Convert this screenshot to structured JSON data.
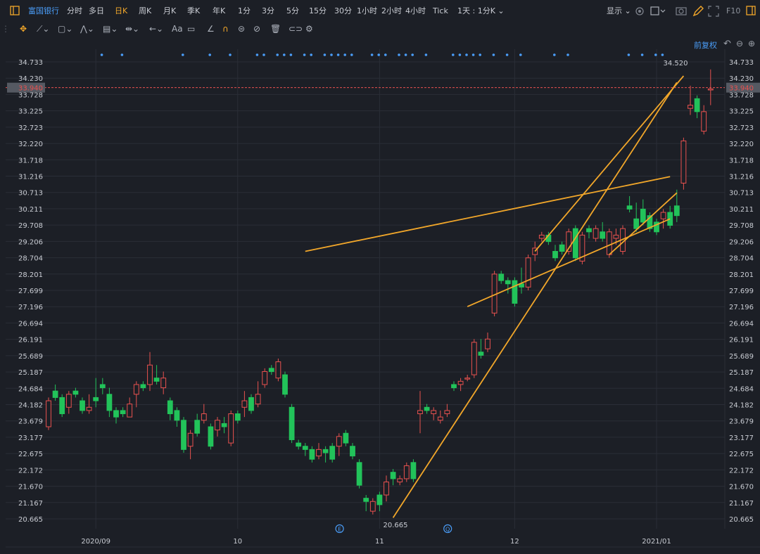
{
  "topbar": {
    "stock_name": "富国银行",
    "periods": [
      "分时",
      "多日",
      "日K",
      "周K",
      "月K",
      "季K",
      "年K",
      "1分",
      "3分",
      "5分",
      "15分",
      "30分",
      "1小时",
      "2小时",
      "4小时",
      "Tick",
      "1天 : 1分K"
    ],
    "active_period": "日K",
    "display_label": "显示",
    "f10_label": "F10"
  },
  "toolbar": {
    "text_tool_label": "Aa"
  },
  "adjust_label": "前复权",
  "colors": {
    "up": "#e8514f",
    "down": "#22c35a",
    "trend": "#f2a72a",
    "bg": "#1c1f26",
    "grid": "#2a2e37",
    "accent": "#4a9df8"
  },
  "chart_data": {
    "type": "candlestick",
    "current_price": "33.940",
    "high_label": "34.520",
    "low_label": "20.665",
    "ylim": [
      20.3,
      35.2
    ],
    "y_ticks": [
      "34.733",
      "34.230",
      "33.728",
      "33.225",
      "32.723",
      "32.220",
      "31.718",
      "31.216",
      "30.713",
      "30.211",
      "29.708",
      "29.206",
      "28.704",
      "28.201",
      "27.699",
      "27.196",
      "26.694",
      "26.191",
      "25.689",
      "25.187",
      "24.684",
      "24.182",
      "23.679",
      "23.177",
      "22.675",
      "22.172",
      "21.670",
      "21.167",
      "20.665"
    ],
    "x_labels": [
      {
        "label": "2020/09",
        "index": 7
      },
      {
        "label": "10",
        "index": 28
      },
      {
        "label": "11",
        "index": 49
      },
      {
        "label": "12",
        "index": 69
      },
      {
        "label": "2021/01",
        "index": 90
      }
    ],
    "candles": [
      [
        23.5,
        24.3,
        23.4,
        24.4
      ],
      [
        24.6,
        24.4,
        24.3,
        24.8
      ],
      [
        24.4,
        23.9,
        23.8,
        24.5
      ],
      [
        24.1,
        24.5,
        23.9,
        24.6
      ],
      [
        24.6,
        24.5,
        24.4,
        24.7
      ],
      [
        24.3,
        24.0,
        23.9,
        24.4
      ],
      [
        24.0,
        24.1,
        23.9,
        24.5
      ],
      [
        24.4,
        24.3,
        24.1,
        25.0
      ],
      [
        24.8,
        24.7,
        24.5,
        25.0
      ],
      [
        24.5,
        24.0,
        23.8,
        24.7
      ],
      [
        24.0,
        23.8,
        23.6,
        24.1
      ],
      [
        24.0,
        23.9,
        23.8,
        24.1
      ],
      [
        23.8,
        24.2,
        23.8,
        24.4
      ],
      [
        24.5,
        24.8,
        24.1,
        24.9
      ],
      [
        24.8,
        24.7,
        24.6,
        24.9
      ],
      [
        24.8,
        25.4,
        24.6,
        25.8
      ],
      [
        25.0,
        24.9,
        24.8,
        25.4
      ],
      [
        24.7,
        25.0,
        24.5,
        25.2
      ],
      [
        24.3,
        23.9,
        23.7,
        24.4
      ],
      [
        24.0,
        23.7,
        23.5,
        24.1
      ],
      [
        23.7,
        22.8,
        22.7,
        23.8
      ],
      [
        22.9,
        23.3,
        22.5,
        23.4
      ],
      [
        23.7,
        23.3,
        23.2,
        23.9
      ],
      [
        23.7,
        23.9,
        23.6,
        24.2
      ],
      [
        23.5,
        22.9,
        22.8,
        23.6
      ],
      [
        23.4,
        23.7,
        23.2,
        23.8
      ],
      [
        23.6,
        23.5,
        23.3,
        23.8
      ],
      [
        23.0,
        23.9,
        22.9,
        24.0
      ],
      [
        23.9,
        23.7,
        23.6,
        24.0
      ],
      [
        24.1,
        24.3,
        23.8,
        24.6
      ],
      [
        24.4,
        24.0,
        23.9,
        24.5
      ],
      [
        24.2,
        24.5,
        24.1,
        24.9
      ],
      [
        24.8,
        25.2,
        24.7,
        25.3
      ],
      [
        25.3,
        25.2,
        25.1,
        25.4
      ],
      [
        25.0,
        25.5,
        24.9,
        25.6
      ],
      [
        25.1,
        24.5,
        24.4,
        25.2
      ],
      [
        24.1,
        23.1,
        23.0,
        24.2
      ],
      [
        23.0,
        22.9,
        22.8,
        23.1
      ],
      [
        22.9,
        22.8,
        22.6,
        23.0
      ],
      [
        22.8,
        22.5,
        22.4,
        22.9
      ],
      [
        22.6,
        22.8,
        22.5,
        23.0
      ],
      [
        22.8,
        22.7,
        22.4,
        22.9
      ],
      [
        22.9,
        22.5,
        22.4,
        23.0
      ],
      [
        22.9,
        23.2,
        22.6,
        23.3
      ],
      [
        23.3,
        23.0,
        22.9,
        23.4
      ],
      [
        22.9,
        22.6,
        22.5,
        23.0
      ],
      [
        22.4,
        21.7,
        21.6,
        22.5
      ],
      [
        21.3,
        21.2,
        20.9,
        21.4
      ],
      [
        20.9,
        21.2,
        20.8,
        21.3
      ],
      [
        21.4,
        21.1,
        20.9,
        21.5
      ],
      [
        21.4,
        21.8,
        21.2,
        22.0
      ],
      [
        22.1,
        21.9,
        21.7,
        22.2
      ],
      [
        21.8,
        21.9,
        21.7,
        22.0
      ],
      [
        21.9,
        22.3,
        21.8,
        22.4
      ],
      [
        22.4,
        21.9,
        21.8,
        22.5
      ],
      [
        23.9,
        24.0,
        23.3,
        24.6
      ],
      [
        24.1,
        24.0,
        23.9,
        24.2
      ],
      [
        23.9,
        24.0,
        23.7,
        24.1
      ],
      [
        23.7,
        23.8,
        23.6,
        24.0
      ],
      [
        23.9,
        24.0,
        23.8,
        24.2
      ],
      [
        24.8,
        24.7,
        24.6,
        24.9
      ],
      [
        24.8,
        24.9,
        24.6,
        25.0
      ],
      [
        25.0,
        25.0,
        24.9,
        25.1
      ],
      [
        25.1,
        26.1,
        25.0,
        26.2
      ],
      [
        25.8,
        25.7,
        25.6,
        26.2
      ],
      [
        25.9,
        26.2,
        25.8,
        26.4
      ],
      [
        27.0,
        28.2,
        26.9,
        28.3
      ],
      [
        28.2,
        28.0,
        27.9,
        28.3
      ],
      [
        28.0,
        27.9,
        27.6,
        28.1
      ],
      [
        28.0,
        27.3,
        27.2,
        28.1
      ],
      [
        27.9,
        27.8,
        27.6,
        28.4
      ],
      [
        27.8,
        28.7,
        27.7,
        28.8
      ],
      [
        28.8,
        29.0,
        28.6,
        29.2
      ],
      [
        29.3,
        29.4,
        29.2,
        29.5
      ],
      [
        29.4,
        29.2,
        29.1,
        29.5
      ],
      [
        28.9,
        28.7,
        28.6,
        29.1
      ],
      [
        29.1,
        28.9,
        28.8,
        29.2
      ],
      [
        28.9,
        29.5,
        28.8,
        29.6
      ],
      [
        29.6,
        28.7,
        28.6,
        29.7
      ],
      [
        28.6,
        29.4,
        28.5,
        29.5
      ],
      [
        29.6,
        29.5,
        29.3,
        29.7
      ],
      [
        29.3,
        29.6,
        29.2,
        29.7
      ],
      [
        29.5,
        29.3,
        29.2,
        29.8
      ],
      [
        28.8,
        29.5,
        28.7,
        29.6
      ],
      [
        29.3,
        29.4,
        29.1,
        29.6
      ],
      [
        28.9,
        29.6,
        28.8,
        29.7
      ],
      [
        30.3,
        30.2,
        30.1,
        30.6
      ],
      [
        29.9,
        29.6,
        29.5,
        30.4
      ],
      [
        30.2,
        29.8,
        29.7,
        30.5
      ],
      [
        30.0,
        29.6,
        29.5,
        30.1
      ],
      [
        29.8,
        29.5,
        29.4,
        29.9
      ],
      [
        29.9,
        30.1,
        29.6,
        30.2
      ],
      [
        30.1,
        29.7,
        29.6,
        30.3
      ],
      [
        30.3,
        30.0,
        29.8,
        30.8
      ],
      [
        31.0,
        32.3,
        30.8,
        32.4
      ],
      [
        33.3,
        33.4,
        33.1,
        34.0
      ],
      [
        33.6,
        33.2,
        33.0,
        33.7
      ],
      [
        32.6,
        33.2,
        32.5,
        33.4
      ],
      [
        33.9,
        33.9,
        33.4,
        34.5
      ]
    ],
    "trendlines": [
      {
        "from": [
          51,
          20.7
        ],
        "to": [
          93,
          34.1
        ]
      },
      {
        "from": [
          83,
          28.8
        ],
        "to": [
          93,
          30.7
        ]
      },
      {
        "from": [
          38,
          28.9
        ],
        "to": [
          92,
          31.2
        ]
      },
      {
        "from": [
          62,
          27.2
        ],
        "to": [
          92,
          29.9
        ]
      },
      {
        "from": [
          72,
          28.9
        ],
        "to": [
          94,
          34.3
        ]
      }
    ],
    "marker_indices": [
      6,
      9,
      18,
      22,
      25,
      29,
      30,
      32,
      33,
      34,
      36,
      37,
      39,
      40,
      41,
      42,
      43,
      46,
      47,
      48,
      50,
      51,
      52,
      54,
      58,
      59,
      60,
      61,
      62,
      64,
      66,
      68,
      73,
      75,
      84,
      86,
      88,
      89
    ],
    "event_labels": [
      {
        "index": 36,
        "label": "E"
      },
      {
        "index": 52,
        "label": "Q"
      }
    ]
  }
}
